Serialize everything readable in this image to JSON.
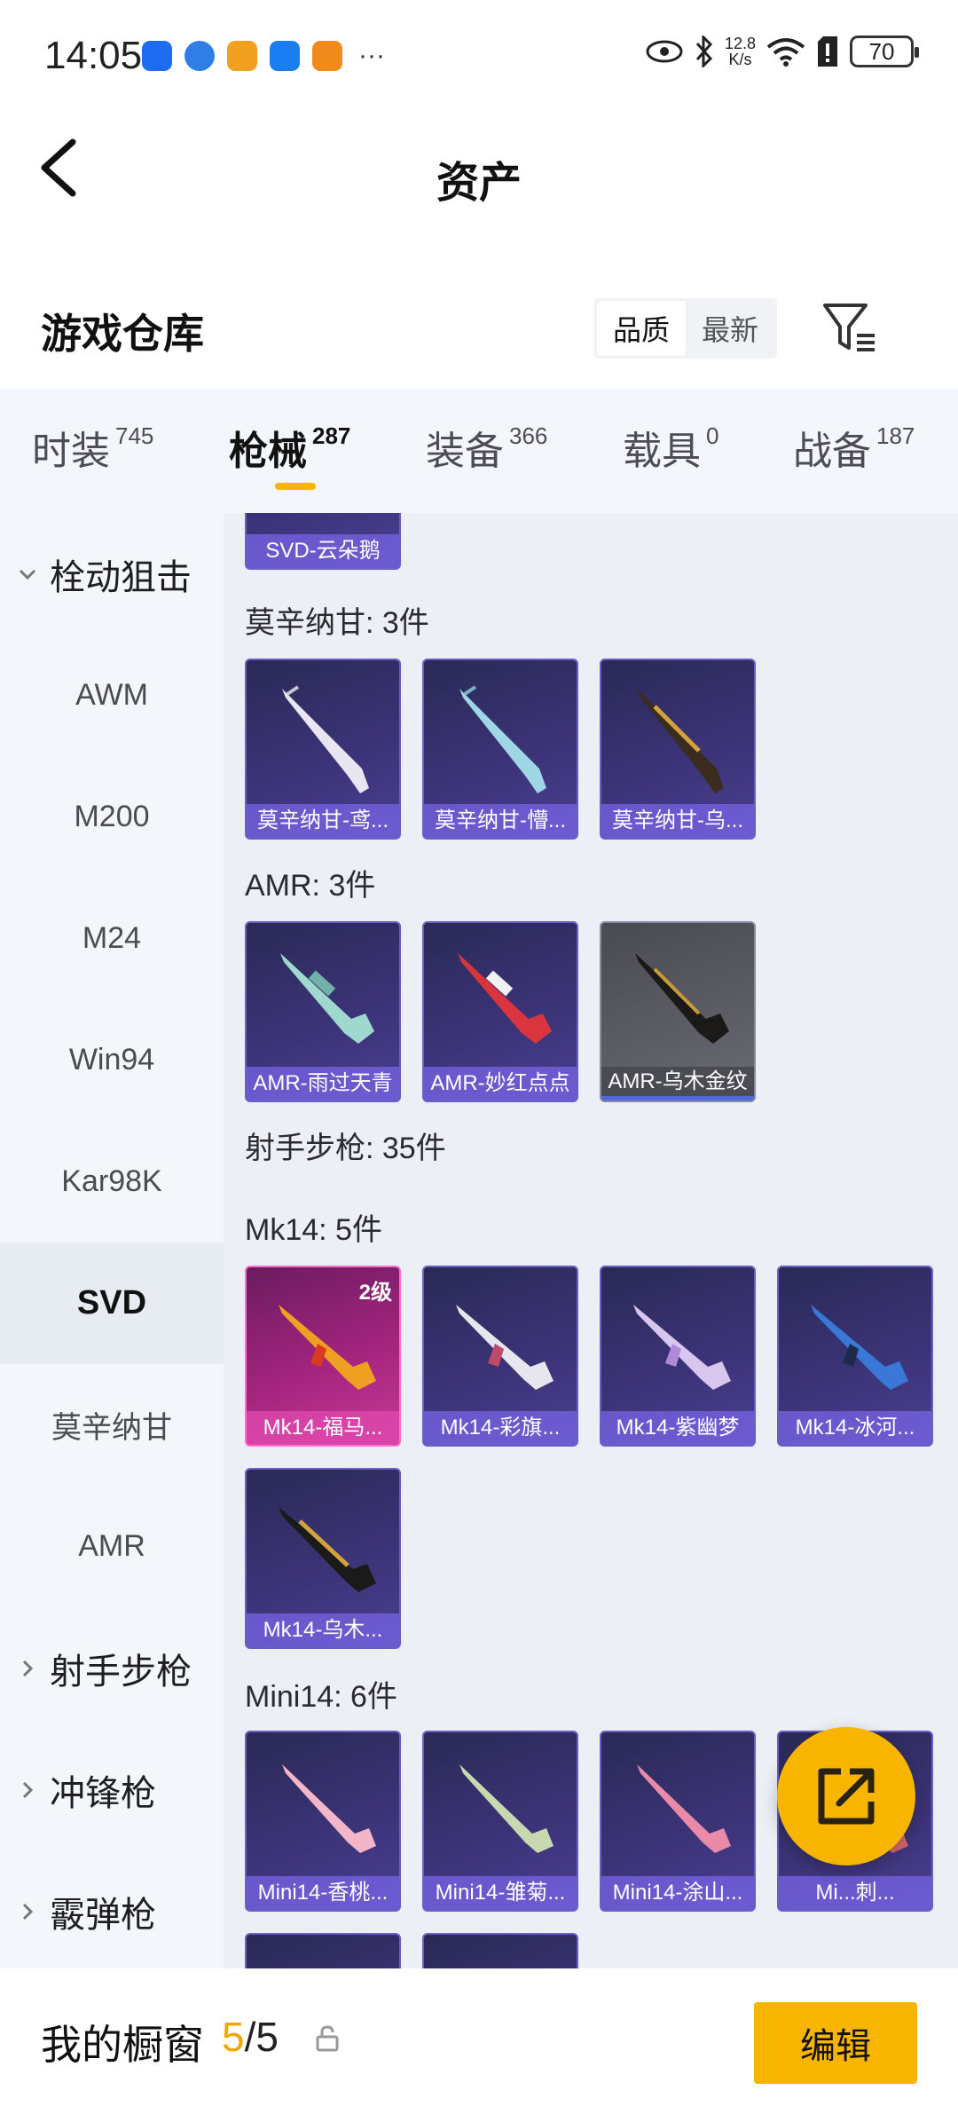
{
  "status_bar": {
    "time": "14:05",
    "more": "···",
    "net_speed_value": "12.8",
    "net_speed_unit": "K/s",
    "battery": "70",
    "app_icon_colors": [
      "#1e6cf2",
      "#2f7ee6",
      "#f2a020",
      "#1a7ef2",
      "#f08a1a"
    ]
  },
  "header": {
    "title": "资产"
  },
  "warehouse": {
    "title": "游戏仓库",
    "sort_options": [
      "品质",
      "最新"
    ],
    "sort_selected": "品质"
  },
  "category_tabs": [
    {
      "label": "时装",
      "count": "745"
    },
    {
      "label": "枪械",
      "count": "287",
      "active": true
    },
    {
      "label": "装备",
      "count": "366"
    },
    {
      "label": "载具",
      "count": "0"
    },
    {
      "label": "战备",
      "count": "187"
    }
  ],
  "sidebar": {
    "items": [
      {
        "label": "栓动狙击",
        "type": "group",
        "expanded": true
      },
      {
        "label": "AWM"
      },
      {
        "label": "M200"
      },
      {
        "label": "M24"
      },
      {
        "label": "Win94"
      },
      {
        "label": "Kar98K"
      },
      {
        "label": "SVD",
        "active": true
      },
      {
        "label": "莫辛纳甘"
      },
      {
        "label": "AMR"
      },
      {
        "label": "射手步枪",
        "type": "group"
      },
      {
        "label": "冲锋枪",
        "type": "group"
      },
      {
        "label": "霰弹枪",
        "type": "group"
      }
    ]
  },
  "content": {
    "partial_top_card": "SVD-云朵鹅",
    "sections": [
      {
        "title": "莫辛纳甘: 3件",
        "cards": [
          "莫辛纳甘-鸢...",
          "莫辛纳甘-懵...",
          "莫辛纳甘-乌..."
        ]
      },
      {
        "title": "AMR: 3件",
        "cards": [
          "AMR-雨过天青",
          "AMR-妙红点点",
          "AMR-乌木金纹"
        ]
      },
      {
        "title": "射手步枪: 35件",
        "cards": []
      },
      {
        "title": "Mk14: 5件",
        "cards": [
          "Mk14-福马...",
          "Mk14-彩旗...",
          "Mk14-紫幽梦",
          "Mk14-冰河...",
          "Mk14-乌木..."
        ]
      },
      {
        "title": "Mini14: 6件",
        "cards": [
          "Mini14-香桃...",
          "Mini14-雏菊...",
          "Mini14-涂山...",
          "Mi...刺..."
        ]
      }
    ],
    "level_badge": "2级"
  },
  "bottom_bar": {
    "label": "我的橱窗",
    "current": "5",
    "separator": "/",
    "total": "5",
    "edit_label": "编辑"
  },
  "colors": {
    "accent": "#f7b500",
    "card_purple": "#3b3377",
    "card_gold": "#a4247e",
    "card_gray": "#5d5d66"
  }
}
